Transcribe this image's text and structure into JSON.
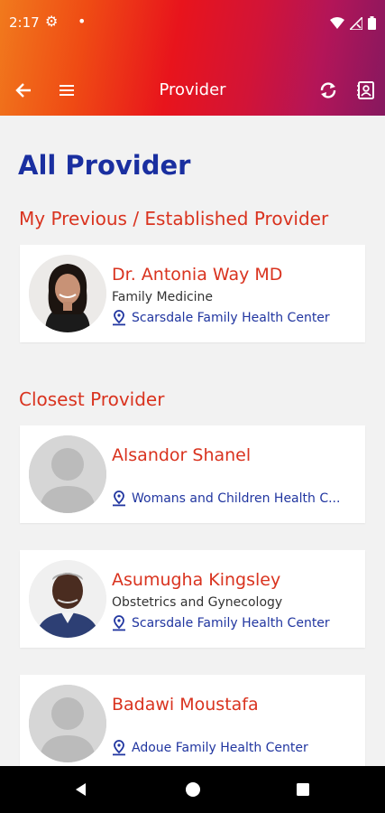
{
  "status": {
    "time": "2:17"
  },
  "toolbar": {
    "title": "Provider"
  },
  "page": {
    "title": "All Provider"
  },
  "sections": {
    "previous": "My Previous / Established Provider",
    "closest": "Closest Provider"
  },
  "providers": [
    {
      "name": "Dr. Antonia Way MD",
      "specialty": "Family Medicine",
      "location": "Scarsdale Family Health Center",
      "avatar": "photo-woman"
    },
    {
      "name": "Alsandor Shanel",
      "specialty": "",
      "location": "Womans and Children Health C...",
      "avatar": "placeholder"
    },
    {
      "name": "Asumugha Kingsley",
      "specialty": "Obstetrics and Gynecology",
      "location": "Scarsdale Family Health Center",
      "avatar": "photo-man"
    },
    {
      "name": "Badawi Moustafa",
      "specialty": "",
      "location": "Adoue Family Health Center",
      "avatar": "placeholder"
    }
  ],
  "icons": {
    "back": "arrow-left-icon",
    "menu": "hamburger-menu-icon",
    "refresh": "refresh-icon",
    "contact": "contact-card-icon",
    "pin": "location-pin-icon"
  },
  "colors": {
    "accent_red": "#d9331f",
    "title_blue": "#1a2fa0",
    "location_blue": "#2136a0"
  }
}
